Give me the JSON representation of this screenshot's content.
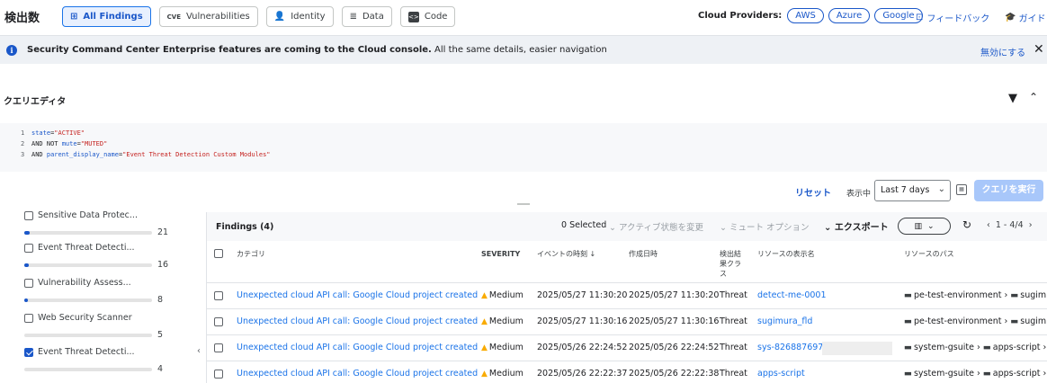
{
  "header": {
    "title": "検出数",
    "tabs": [
      {
        "label": "All Findings",
        "icon": "grid-icon",
        "active": true
      },
      {
        "label": "Vulnerabilities",
        "icon": "cve-icon",
        "active": false
      },
      {
        "label": "Identity",
        "icon": "person-icon",
        "active": false
      },
      {
        "label": "Data",
        "icon": "database-icon",
        "active": false
      },
      {
        "label": "Code",
        "icon": "code-icon",
        "active": false
      }
    ],
    "cloud_providers_label": "Cloud Providers:",
    "providers": [
      "AWS",
      "Azure",
      "Google"
    ],
    "feedback": "フィードバック",
    "guide": "ガイド"
  },
  "banner": {
    "bold": "Security Command Center Enterprise features are coming to the Cloud console.",
    "rest": " All the same details, easier navigation",
    "disable": "無効にする"
  },
  "query_editor": {
    "title": "クエリエディタ",
    "lines": [
      {
        "n": "1",
        "key": "state",
        "op": "=",
        "val": "\"ACTIVE\""
      },
      {
        "n": "2",
        "pre": "AND NOT ",
        "key": "mute",
        "op": "=",
        "val": "\"MUTED\""
      },
      {
        "n": "3",
        "pre": "AND ",
        "key": "parent_display_name",
        "op": "=",
        "val": "\"Event Threat Detection Custom Modules\""
      }
    ],
    "reset": "リセット",
    "show_label": "表示中",
    "time_range": "Last 7 days",
    "run": "クエリを実行"
  },
  "facets": [
    {
      "label": "Sensitive Data Protec...",
      "count": "21",
      "checked": false,
      "fraction": 0.04
    },
    {
      "label": "Event Threat Detecti...",
      "count": "16",
      "checked": false,
      "fraction": 0.04
    },
    {
      "label": "Vulnerability Assess...",
      "count": "8",
      "checked": false,
      "fraction": 0.04
    },
    {
      "label": "Web Security Scanner",
      "count": "5",
      "checked": false,
      "fraction": 0.0
    },
    {
      "label": "Event Threat Detecti...",
      "count": "4",
      "checked": true,
      "fraction": 0.0
    }
  ],
  "findings": {
    "title": "Findings (4)",
    "selected": "0 Selected",
    "change_state": "アクティブ状態を変更",
    "mute_options": "ミュート オプション",
    "export": "エクスポート",
    "pager": "1 - 4/4",
    "columns": {
      "category": "カテゴリ",
      "severity": "SEVERITY",
      "event_time": "イベントの時刻 ↓",
      "created": "作成日時",
      "finding_class": "検出結果クラス",
      "resource_name": "リソースの表示名",
      "resource_path": "リソースのパス"
    },
    "rows": [
      {
        "category": "Unexpected cloud API call: Google Cloud project created",
        "severity": "Medium",
        "event_time": "2025/05/27 11:30:20",
        "created": "2025/05/27 11:30:20",
        "class": "Threat",
        "resource": "detect-me-0001",
        "path1": "pe-test-environment",
        "path2": "sugimu"
      },
      {
        "category": "Unexpected cloud API call: Google Cloud project created",
        "severity": "Medium",
        "event_time": "2025/05/27 11:30:16",
        "created": "2025/05/27 11:30:16",
        "class": "Threat",
        "resource": "sugimura_fld",
        "path1": "pe-test-environment",
        "path2": "sugimu"
      },
      {
        "category": "Unexpected cloud API call: Google Cloud project created",
        "severity": "Medium",
        "event_time": "2025/05/26 22:24:52",
        "created": "2025/05/26 22:24:52",
        "class": "Threat",
        "resource": "sys-826887697",
        "path1": "system-gsuite",
        "path2": "apps-script"
      },
      {
        "category": "Unexpected cloud API call: Google Cloud project created",
        "severity": "Medium",
        "event_time": "2025/05/26 22:22:37",
        "created": "2025/05/26 22:22:38",
        "class": "Threat",
        "resource": "apps-script",
        "path1": "system-gsuite",
        "path2": "apps-script"
      }
    ]
  }
}
